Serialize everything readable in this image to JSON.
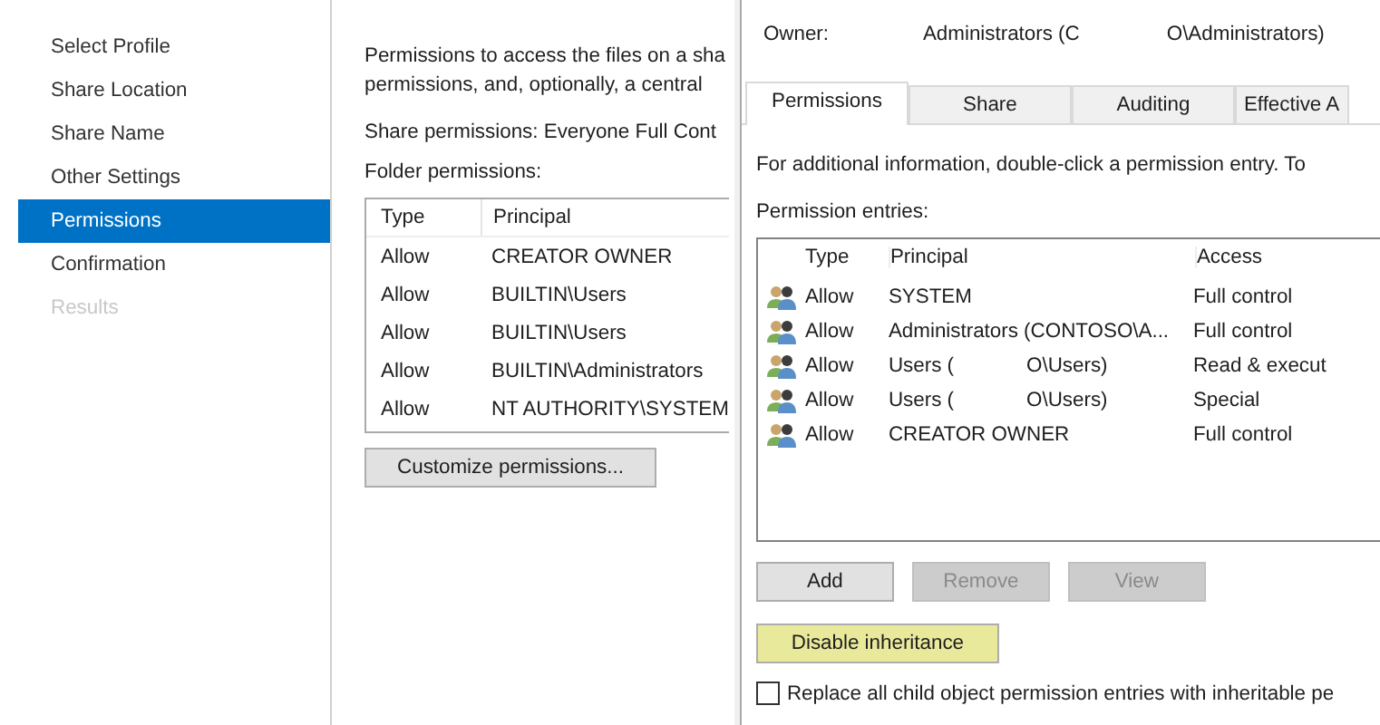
{
  "wizard": {
    "steps": [
      {
        "label": "Select Profile",
        "selected": false,
        "disabled": false
      },
      {
        "label": "Share Location",
        "selected": false,
        "disabled": false
      },
      {
        "label": "Share Name",
        "selected": false,
        "disabled": false
      },
      {
        "label": "Other Settings",
        "selected": false,
        "disabled": false
      },
      {
        "label": "Permissions",
        "selected": true,
        "disabled": false
      },
      {
        "label": "Confirmation",
        "selected": false,
        "disabled": false
      },
      {
        "label": "Results",
        "selected": false,
        "disabled": true
      }
    ],
    "description": [
      "Permissions to access the files on a sha",
      "permissions, and, optionally, a central"
    ],
    "share_permissions": "Share permissions:  Everyone Full Cont",
    "folder_permissions_label": "Folder permissions:",
    "table": {
      "columns": [
        "Type",
        "Principal"
      ],
      "rows": [
        [
          "Allow",
          "CREATOR OWNER"
        ],
        [
          "Allow",
          "BUILTIN\\Users"
        ],
        [
          "Allow",
          "BUILTIN\\Users"
        ],
        [
          "Allow",
          "BUILTIN\\Administrators"
        ],
        [
          "Allow",
          "NT AUTHORITY\\SYSTEM"
        ]
      ]
    },
    "customize_button": "Customize permissions..."
  },
  "dialog": {
    "owner_label": "Owner:",
    "owner_value": "Administrators (C",
    "owner_value_tail": "O\\Administrators)",
    "tabs": [
      {
        "label": "Permissions",
        "selected": true
      },
      {
        "label": "Share",
        "selected": false
      },
      {
        "label": "Auditing",
        "selected": false
      },
      {
        "label": "Effective A",
        "selected": false
      }
    ],
    "info": "For additional information, double-click a permission entry. To",
    "entries_label": "Permission entries:",
    "columns": [
      "Type",
      "Principal",
      "Access"
    ],
    "entries": [
      {
        "type": "Allow",
        "principal": "SYSTEM",
        "access": "Full control"
      },
      {
        "type": "Allow",
        "principal": "Administrators (CONTOSO\\A...",
        "access": "Full control"
      },
      {
        "type": "Allow",
        "principal": "Users (",
        "principal_tail": "O\\Users)",
        "access": "Read & execut"
      },
      {
        "type": "Allow",
        "principal": "Users (",
        "principal_tail": "O\\Users)",
        "access": "Special"
      },
      {
        "type": "Allow",
        "principal": "CREATOR OWNER",
        "access": "Full control"
      }
    ],
    "buttons": [
      {
        "label": "Add",
        "disabled": false
      },
      {
        "label": "Remove",
        "disabled": true
      },
      {
        "label": "View",
        "disabled": true
      }
    ],
    "inheritance_button": {
      "label": "Disable inheritance",
      "highlighted": true
    },
    "replace_checkbox": {
      "label": "Replace all child object permission entries with inheritable pe",
      "checked": false
    }
  }
}
